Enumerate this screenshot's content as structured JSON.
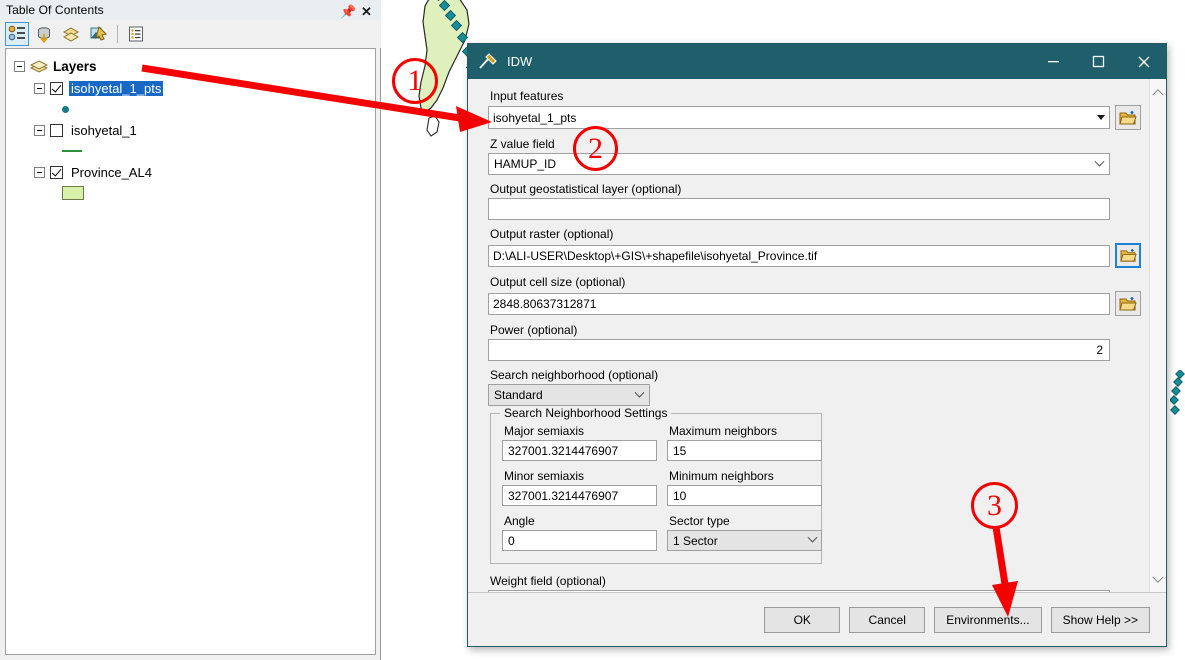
{
  "toc": {
    "title": "Table Of Contents",
    "pin_icon": "pin-icon",
    "close_icon": "close-icon",
    "toolbar": [
      {
        "name": "list-by-drawing-order-icon",
        "active": true
      },
      {
        "name": "list-by-source-icon",
        "active": false
      },
      {
        "name": "list-by-visibility-icon",
        "active": false
      },
      {
        "name": "list-by-selection-icon",
        "active": false
      },
      {
        "name": "options-icon",
        "active": false
      }
    ],
    "root_label": "Layers",
    "layers": [
      {
        "name": "isohyetal_1_pts",
        "checked": true,
        "selected": true,
        "symbol": "point",
        "symbol_color": "#1a7a82"
      },
      {
        "name": "isohyetal_1",
        "checked": false,
        "selected": false,
        "symbol": "line",
        "symbol_color": "#2f8f3f"
      },
      {
        "name": "Province_AL4",
        "checked": true,
        "selected": false,
        "symbol": "polygon",
        "symbol_color": "#d9f0a8"
      }
    ]
  },
  "dialog": {
    "title": "IDW",
    "title_icon": "geoprocessing-tool-icon",
    "titlebar_color": "#1e5f6b",
    "minimize_label": "Minimize",
    "maximize_label": "Maximize",
    "close_label": "Close",
    "fields": {
      "input_features": {
        "label": "Input features",
        "value": "isohyetal_1_pts",
        "browse_icon": "open-folder-icon"
      },
      "z_value_field": {
        "label": "Z value field",
        "value": "HAMUP_ID"
      },
      "output_geostatistical_layer": {
        "label": "Output geostatistical layer (optional)",
        "value": ""
      },
      "output_raster": {
        "label": "Output raster (optional)",
        "value": "D:\\ALI-USER\\Desktop\\+GIS\\+shapefile\\isohyetal_Province.tif",
        "browse_icon": "open-folder-icon"
      },
      "output_cell_size": {
        "label": "Output cell size (optional)",
        "value": "2848.80637312871",
        "browse_icon": "open-folder-icon"
      },
      "power": {
        "label": "Power (optional)",
        "value": "2"
      },
      "search_neighborhood": {
        "label": "Search neighborhood (optional)",
        "value": "Standard"
      },
      "weight_field": {
        "label": "Weight field (optional)",
        "value": ""
      }
    },
    "neighborhood_group": {
      "title": "Search Neighborhood Settings",
      "major_semiaxis": {
        "label": "Major semiaxis",
        "value": "327001.3214476907"
      },
      "maximum_neighbors": {
        "label": "Maximum neighbors",
        "value": "15"
      },
      "minor_semiaxis": {
        "label": "Minor semiaxis",
        "value": "327001.3214476907"
      },
      "minimum_neighbors": {
        "label": "Minimum neighbors",
        "value": "10"
      },
      "angle": {
        "label": "Angle",
        "value": "0"
      },
      "sector_type": {
        "label": "Sector type",
        "value": "1 Sector"
      }
    },
    "buttons": {
      "ok": "OK",
      "cancel": "Cancel",
      "environments": "Environments...",
      "show_help": "Show Help >>"
    },
    "scrollbar": {
      "up_icon": "chevron-up-icon",
      "down_icon": "chevron-down-icon"
    }
  },
  "annotations": {
    "color": "#f50000",
    "marker_1": "1",
    "marker_2": "2",
    "marker_3": "3"
  },
  "map": {
    "polygon_fill": "#dff0bc",
    "point_color": "#1a8d99"
  }
}
